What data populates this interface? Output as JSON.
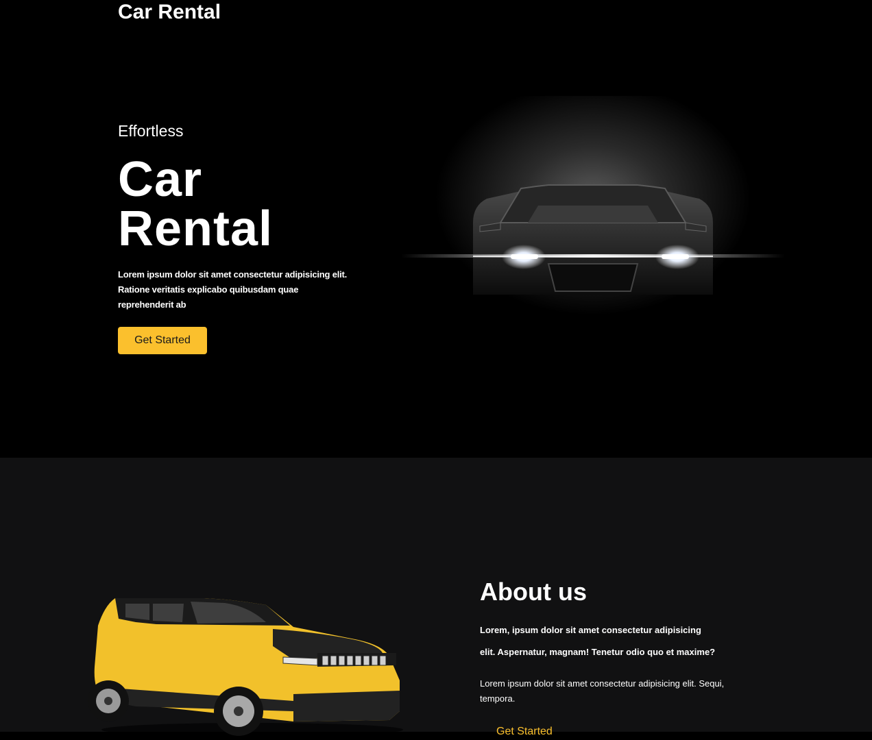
{
  "header": {
    "brand": "Car Rental"
  },
  "hero": {
    "kicker": "Effortless",
    "title_line1": "Car",
    "title_line2": "Rental",
    "description": "Lorem ipsum dolor sit amet consectetur adipisicing elit. Ratione veritatis explicabo quibusdam quae reprehenderit ab",
    "cta_label": "Get Started"
  },
  "about": {
    "title": "About us",
    "paragraph1_line1": "Lorem, ipsum dolor sit amet consectetur adipisicing",
    "paragraph1_line2": "elit. Aspernatur, magnam! Tenetur odio quo et maxime?",
    "paragraph2": "Lorem ipsum dolor sit amet consectetur adipisicing elit. Sequi, tempora.",
    "cta_label": "Get Started"
  },
  "colors": {
    "accent": "#fbc02d",
    "hero_bg": "#000000",
    "about_bg": "#111112",
    "text": "#ffffff"
  }
}
